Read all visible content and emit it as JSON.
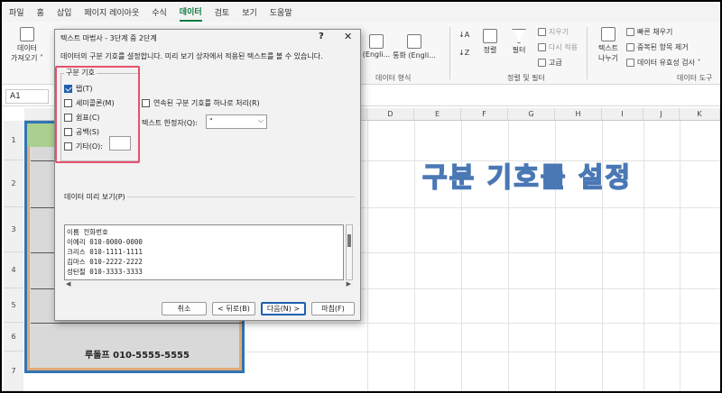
{
  "tabs": [
    "파일",
    "홈",
    "삽입",
    "페이지 레이아웃",
    "수식",
    "데이터",
    "검토",
    "보기",
    "도움말"
  ],
  "ribbon": {
    "get_data": [
      "데이터",
      "가져오기 ˅"
    ],
    "stocks": "(Engli...",
    "currency": "통화 (Engli...",
    "data_type_group": "데이터 형식",
    "sort": "정렬",
    "filter": "필터",
    "clear": "지우기",
    "reapply": "다시 적용",
    "advanced": "고급",
    "sort_filter_group": "정렬 및 필터",
    "text_to_columns": [
      "텍스트",
      "나누기"
    ],
    "flash_fill": "빠른 채우기",
    "remove_duplicates": "중복된 항목 제거",
    "data_validation": "데이터 유효성 검사 ˅",
    "data_tools_group": "데이터 도구"
  },
  "namebox": "A1",
  "columns": [
    "D",
    "E",
    "F",
    "G",
    "H",
    "I",
    "J",
    "K"
  ],
  "rows": [
    "1",
    "2",
    "3",
    "4",
    "5",
    "6",
    "7"
  ],
  "cell_a7": "루돌프 010-5555-5555",
  "overlay_title": "구분 기호를 설정",
  "dialog": {
    "title": "텍스트 마법사 - 3단계 중 2단계",
    "help": "?",
    "close": "✕",
    "description": "데이터의 구분 기호를 설정합니다. 미리 보기 상자에서 적용된 텍스트를 볼 수 있습니다.",
    "delimiter_group": "구분 기호",
    "delimiters": [
      {
        "label": "탭(T)",
        "checked": true
      },
      {
        "label": "세미콜론(M)",
        "checked": false
      },
      {
        "label": "쉼표(C)",
        "checked": false
      },
      {
        "label": "공백(S)",
        "checked": false
      },
      {
        "label": "기타(O):",
        "checked": false
      }
    ],
    "consecutive": "연속된 구분 기호를 하나로 처리(R)",
    "qualifier_label": "텍스트 한정자(Q):",
    "qualifier_value": "\"",
    "preview_label": "데이터 미리 보기(P)",
    "preview_rows": [
      "이름 전화번호",
      "이예리 010-0000-0000",
      "크리스 010-1111-1111",
      "김마스 010-2222-2222",
      "성탄절 010-3333-3333"
    ],
    "buttons": {
      "cancel": "취소",
      "back": "< 뒤로(B)",
      "next": "다음(N) >",
      "finish": "마침(F)"
    }
  }
}
